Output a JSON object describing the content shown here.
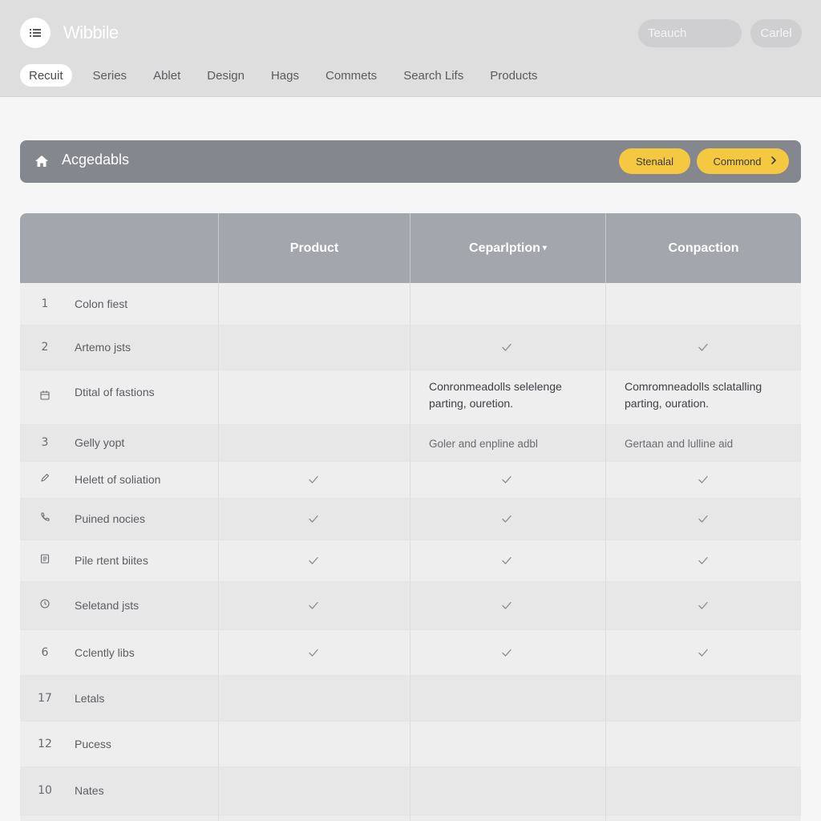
{
  "header": {
    "app_title": "Wibbile",
    "menu_icon": "list-icon",
    "search_placeholder": "Teauch",
    "cancel_label": "Carlel",
    "nav": {
      "tabs": [
        {
          "label": "Recuit",
          "active": true
        },
        {
          "label": "Series",
          "active": false
        },
        {
          "label": "Ablet",
          "active": false
        },
        {
          "label": "Design",
          "active": false
        },
        {
          "label": "Hags",
          "active": false
        },
        {
          "label": "Commets",
          "active": false
        },
        {
          "label": "Search Lifs",
          "active": false
        },
        {
          "label": "Products",
          "active": false
        }
      ]
    }
  },
  "action_bar": {
    "icon": "home-icon",
    "title": "Acgedabls",
    "standard_label": "Stenalal",
    "command_label": "Commond",
    "command_icon": "chevron-right-icon"
  },
  "table": {
    "columns": [
      "",
      "Product",
      "Ceparlption",
      "Conpaction"
    ],
    "sort_indicator": "▾",
    "rows": [
      {
        "marker": "1",
        "marker_type": "number",
        "label": "Colon fiest",
        "c1": "",
        "c2": "",
        "c3": ""
      },
      {
        "marker": "2",
        "marker_type": "number",
        "label": "Artemo jsts",
        "c1": "",
        "c2": "check",
        "c3": "check"
      },
      {
        "marker": "calendar-icon",
        "marker_type": "icon",
        "label": "Dtital of fastions",
        "c1": "",
        "c2": "Conronmeadolls selelenge parting, ouretion.",
        "c3": "Comromneadolls sclatalling parting, ouration."
      },
      {
        "marker": "3",
        "marker_type": "number",
        "label": "Gelly yopt",
        "c1": "",
        "c2": "Goler and enpline adbl",
        "c3": "Gertaan and lulline aid"
      },
      {
        "marker": "pen-icon",
        "marker_type": "icon",
        "label": "Helett of soliation",
        "c1": "check",
        "c2": "check",
        "c3": "check"
      },
      {
        "marker": "phone-icon",
        "marker_type": "icon",
        "label": "Puined nocies",
        "c1": "check",
        "c2": "check",
        "c3": "check"
      },
      {
        "marker": "document-icon",
        "marker_type": "icon",
        "label": "Pile rtent biites",
        "c1": "check",
        "c2": "check",
        "c3": "check"
      },
      {
        "marker": "clock-icon",
        "marker_type": "icon",
        "label": "Seletand jsts",
        "c1": "check",
        "c2": "check",
        "c3": "check"
      },
      {
        "marker": "6",
        "marker_type": "number",
        "label": "Cclently libs",
        "c1": "check",
        "c2": "check",
        "c3": "check"
      },
      {
        "marker": "17",
        "marker_type": "number",
        "label": "Letals",
        "c1": "",
        "c2": "",
        "c3": ""
      },
      {
        "marker": "12",
        "marker_type": "number",
        "label": "Pucess",
        "c1": "",
        "c2": "",
        "c3": ""
      },
      {
        "marker": "10",
        "marker_type": "number",
        "label": "Nates",
        "c1": "",
        "c2": "",
        "c3": ""
      }
    ]
  },
  "colors": {
    "accent_yellow": "#f5c842",
    "header_bg": "#dededf",
    "action_bar_bg": "#85878f",
    "table_header_bg": "#a4a6ad"
  }
}
